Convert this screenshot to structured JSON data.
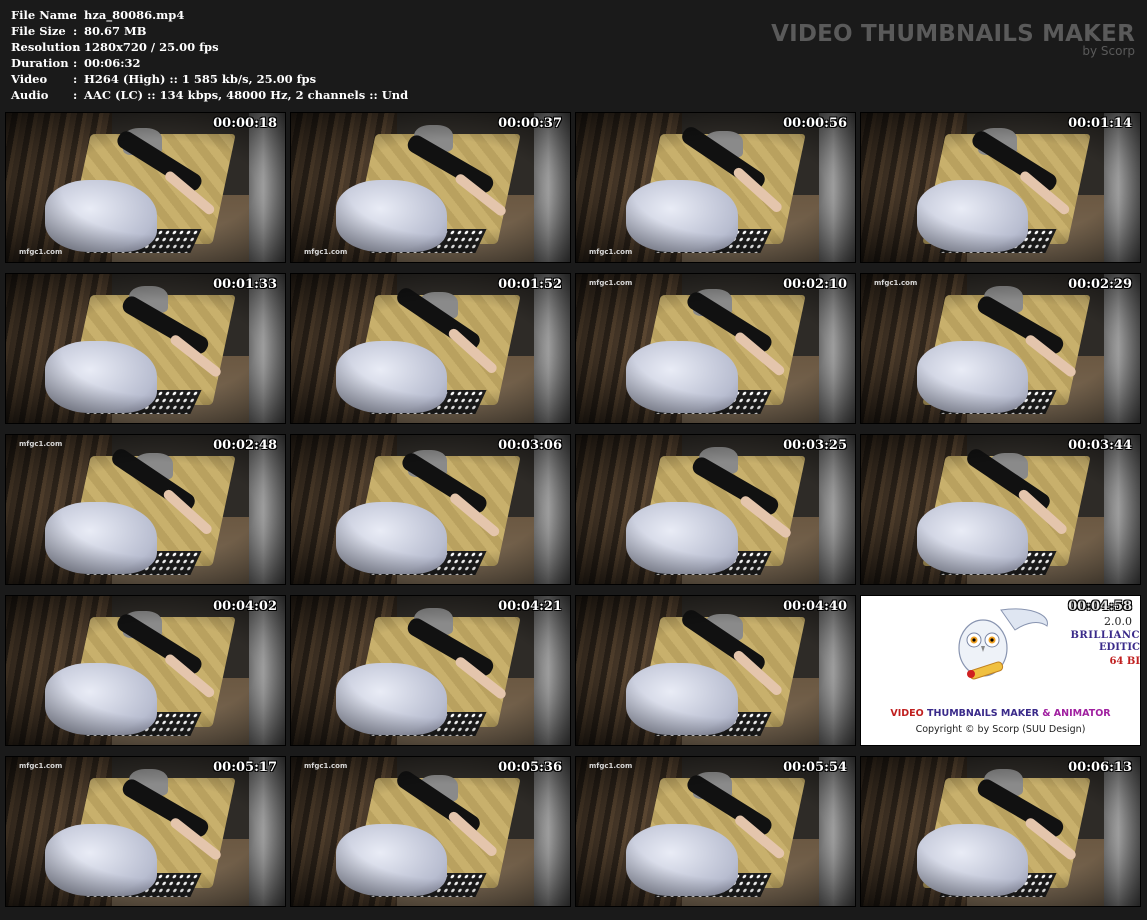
{
  "info": [
    {
      "key": "File Name",
      "value": "hza_80086.mp4"
    },
    {
      "key": "File Size",
      "value": "80.67 MB"
    },
    {
      "key": "Resolution",
      "value": "1280x720 / 25.00 fps"
    },
    {
      "key": "Duration",
      "value": "00:06:32"
    },
    {
      "key": "Video",
      "value": "H264 (High) :: 1 585 kb/s, 25.00 fps"
    },
    {
      "key": "Audio",
      "value": "AAC (LC) :: 134 kbps, 48000 Hz, 2 channels :: Und"
    }
  ],
  "separator": ":",
  "brand": {
    "title": "VIDEO THUMBNAILS MAKER",
    "subtitle": "by Scorp"
  },
  "watermark": "mfgc1.com",
  "thumbnails": [
    {
      "time": "00:00:18",
      "wm": "bottom"
    },
    {
      "time": "00:00:37",
      "wm": "bottom"
    },
    {
      "time": "00:00:56",
      "wm": "bottom"
    },
    {
      "time": "00:01:14",
      "wm": "none"
    },
    {
      "time": "00:01:33",
      "wm": "none"
    },
    {
      "time": "00:01:52",
      "wm": "none"
    },
    {
      "time": "00:02:10",
      "wm": "top"
    },
    {
      "time": "00:02:29",
      "wm": "top"
    },
    {
      "time": "00:02:48",
      "wm": "top"
    },
    {
      "time": "00:03:06",
      "wm": "none"
    },
    {
      "time": "00:03:25",
      "wm": "none"
    },
    {
      "time": "00:03:44",
      "wm": "none"
    },
    {
      "time": "00:04:02",
      "wm": "none"
    },
    {
      "time": "00:04:21",
      "wm": "none"
    },
    {
      "time": "00:04:40",
      "wm": "none"
    },
    {
      "time": "00:04:58",
      "wm": "promo"
    },
    {
      "time": "00:05:17",
      "wm": "top"
    },
    {
      "time": "00:05:36",
      "wm": "top"
    },
    {
      "time": "00:05:54",
      "wm": "top"
    },
    {
      "time": "00:06:13",
      "wm": "none"
    }
  ],
  "promo": {
    "version": "2.0.0",
    "edition_line1": "BRILLIANC",
    "edition_line2": "EDITIC",
    "bits": "64 BI",
    "title_part1": "VIDEO",
    "title_part2": "THUMBNAILS MAKER",
    "title_part3": "& ANIMATOR",
    "copyright": "Copyright © by Scorp (SUU Design)",
    "colors": {
      "part1": "#c02020",
      "part2": "#3a2a8a",
      "part3": "#a020a0"
    }
  }
}
